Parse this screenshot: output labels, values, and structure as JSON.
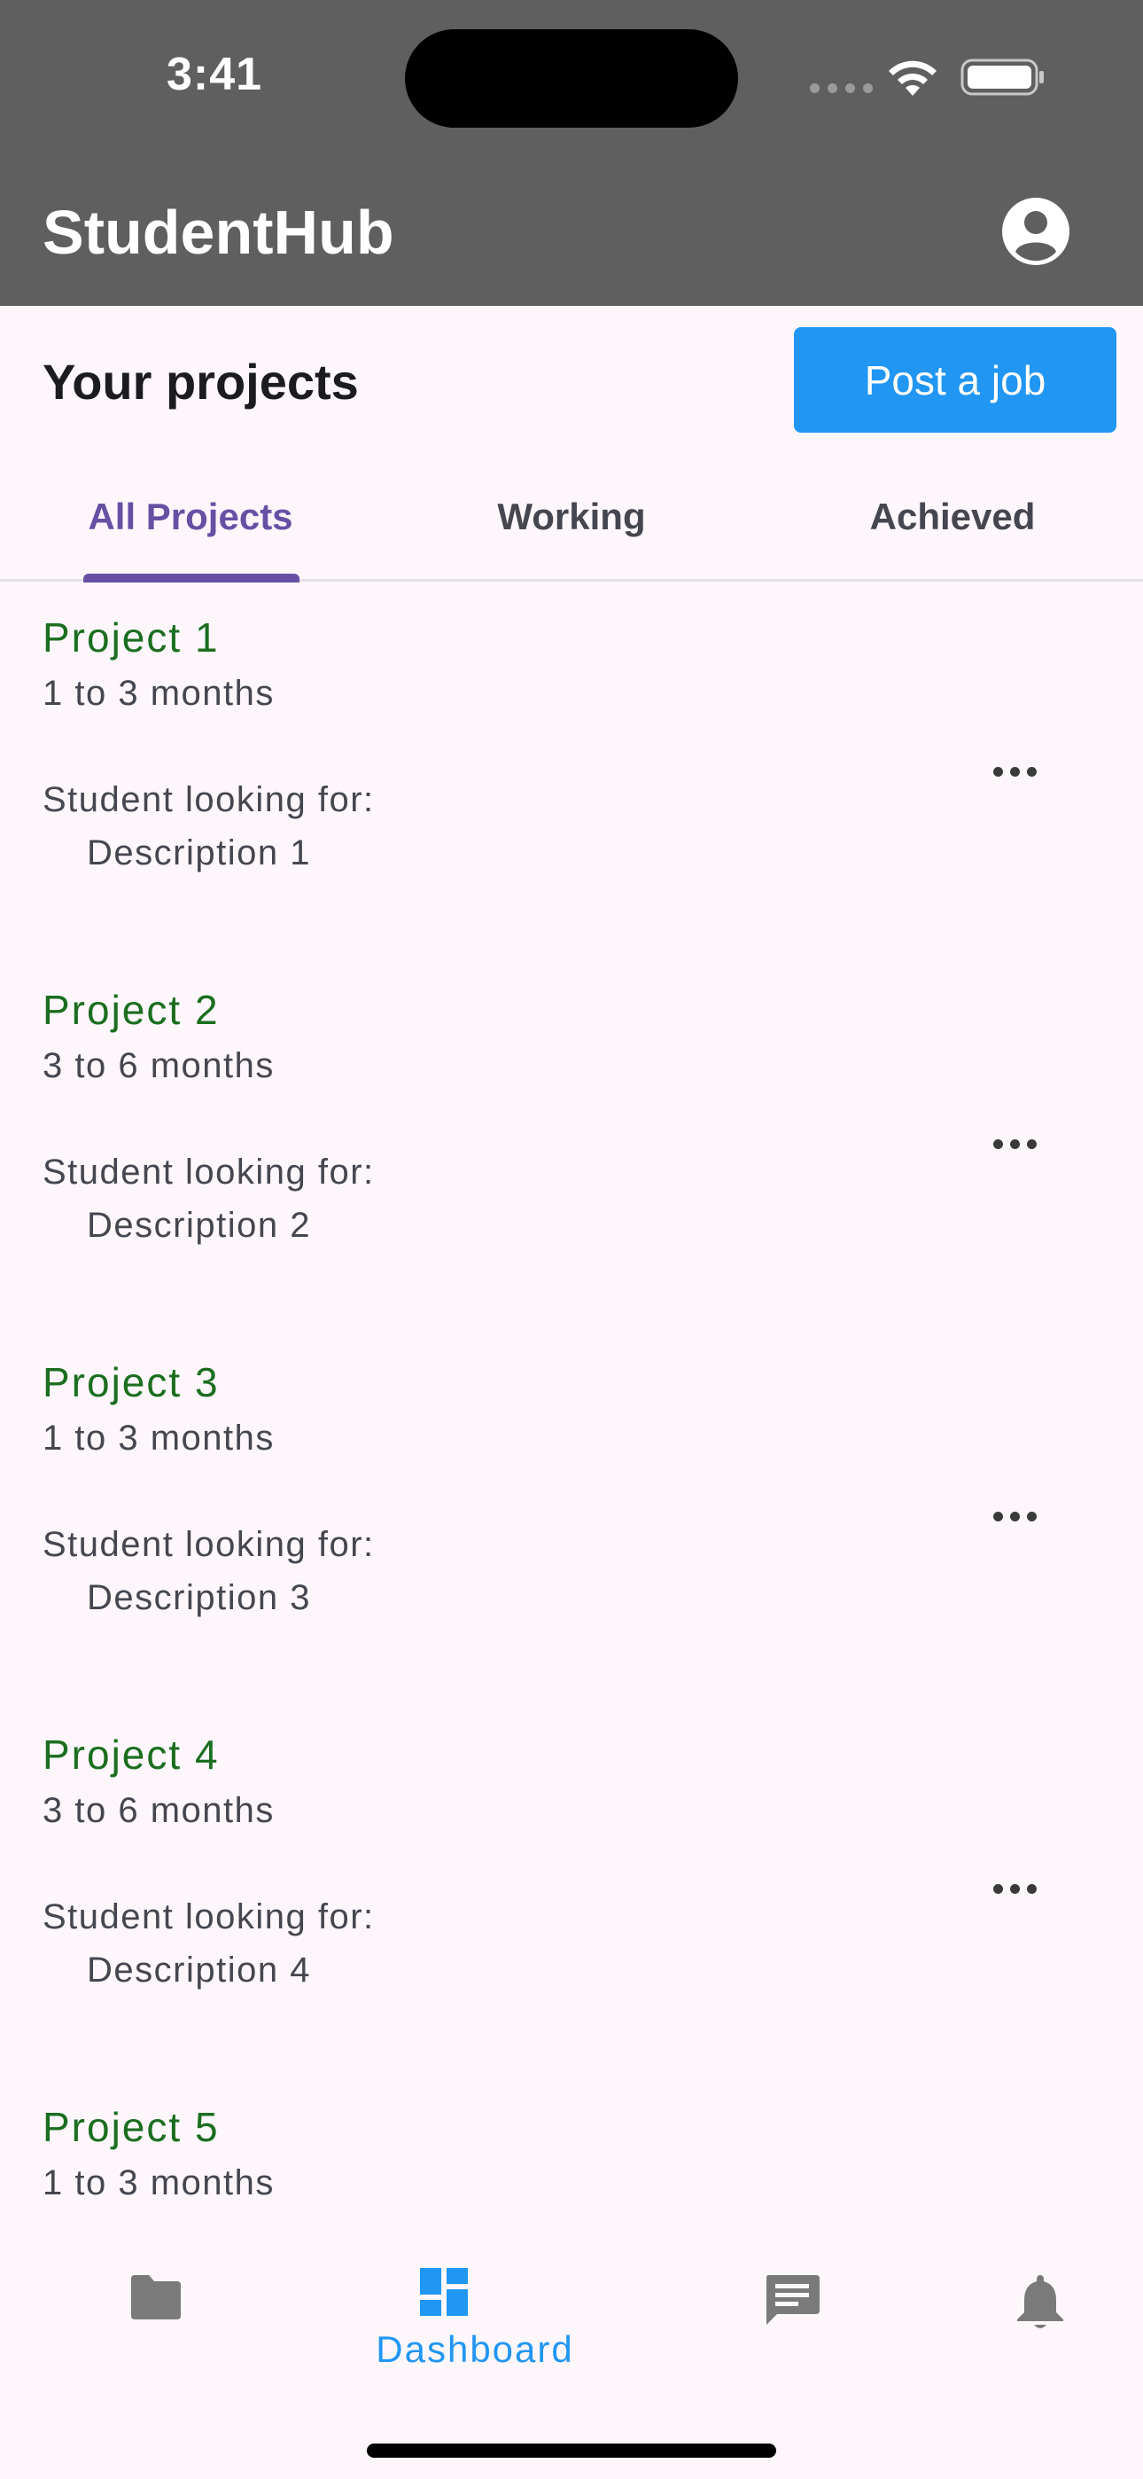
{
  "status_bar": {
    "time": "3:41"
  },
  "app_bar": {
    "title": "StudentHub",
    "account_icon": "account-circle-icon"
  },
  "header": {
    "title": "Your projects",
    "post_button": "Post a job"
  },
  "tabs": [
    {
      "label": "All Projects",
      "active": true
    },
    {
      "label": "Working",
      "active": false
    },
    {
      "label": "Achieved",
      "active": false
    }
  ],
  "projects": [
    {
      "title": "Project 1",
      "duration": "1 to 3 months",
      "looking_for": "Student looking for:",
      "description": "Description 1"
    },
    {
      "title": "Project 2",
      "duration": "3 to 6 months",
      "looking_for": "Student looking for:",
      "description": "Description 2"
    },
    {
      "title": "Project 3",
      "duration": "1 to 3 months",
      "looking_for": "Student looking for:",
      "description": "Description 3"
    },
    {
      "title": "Project 4",
      "duration": "3 to 6 months",
      "looking_for": "Student looking for:",
      "description": "Description 4"
    },
    {
      "title": "Project 5",
      "duration": "1 to 3 months",
      "looking_for": "",
      "description": ""
    }
  ],
  "bottom_nav": [
    {
      "icon": "folder-icon",
      "label": ""
    },
    {
      "icon": "dashboard-icon",
      "label": "Dashboard",
      "active": true
    },
    {
      "icon": "message-icon",
      "label": ""
    },
    {
      "icon": "bell-icon",
      "label": ""
    }
  ],
  "colors": {
    "app_bar": "#5f5f5f",
    "accent": "#2196f3",
    "tab_active": "#6750a4",
    "project_title": "#1b6e1f",
    "background": "#fdf7fc"
  }
}
